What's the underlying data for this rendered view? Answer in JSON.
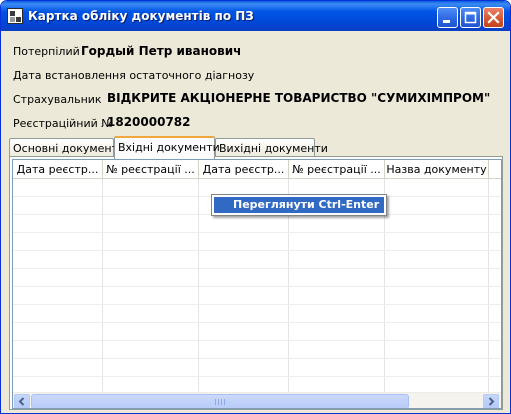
{
  "window": {
    "title": "Картка обліку документів по ПЗ",
    "controls": [
      "minimize-icon",
      "maximize-icon",
      "close-icon"
    ]
  },
  "info": {
    "victim_label": "Потерпілий",
    "victim_value": "Гордый Петр иванович",
    "diagnosis_label": "Дата встановлення остаточного діагнозу",
    "insurer_label": "Страхувальник",
    "insurer_value": "ВІДКРИТЕ АКЦІОНЕРНЕ ТОВАРИСТВО \"СУМИХІМПРОМ\"",
    "reg_label": "Реєстраційний №",
    "reg_value": "1820000782"
  },
  "tabs": [
    {
      "label": "Основні документи",
      "active": false
    },
    {
      "label": "Вхідні документи",
      "active": true
    },
    {
      "label": "Вихідні документи",
      "active": false
    }
  ],
  "grid": {
    "columns": [
      "Дата реєстр...",
      "№ реєстрації ...",
      "Дата реєстр...",
      "№ реєстрації ...",
      "Назва документу"
    ]
  },
  "context_menu": {
    "item": "Переглянути  Ctrl-Enter"
  },
  "colors": {
    "titlebar": "#0055e5",
    "window_bg": "#ece9d8",
    "menu_highlight": "#316ac5",
    "active_tab_accent": "#f2a640"
  }
}
